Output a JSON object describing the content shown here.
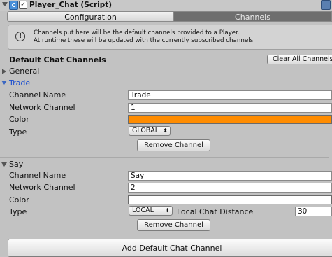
{
  "header": {
    "component_title": "Player_Chat (Script)",
    "enabled_check": "✓",
    "script_icon_glyph": "C"
  },
  "tabs": [
    {
      "label": "Configuration",
      "active": false
    },
    {
      "label": "Channels",
      "active": true
    }
  ],
  "helpbox": {
    "icon": "info-icon",
    "icon_glyph": "!",
    "line1": "Channels put here will be the default channels provided to a Player.",
    "line2": "At runtime these will be updated with the currently subscribed channels"
  },
  "section": {
    "title": "Default Chat Channels",
    "clear_all_label": "Clear All Channels"
  },
  "channels": [
    {
      "name": "General",
      "expanded": false
    },
    {
      "name": "Trade",
      "expanded": true,
      "fields": {
        "channel_name_label": "Channel Name",
        "channel_name_value": "Trade",
        "network_channel_label": "Network Channel",
        "network_channel_value": "1",
        "color_label": "Color",
        "color_value": "#ff8c00",
        "type_label": "Type",
        "type_value": "GLOBAL"
      },
      "remove_label": "Remove Channel"
    },
    {
      "name": "Say",
      "expanded": true,
      "fields": {
        "channel_name_label": "Channel Name",
        "channel_name_value": "Say",
        "network_channel_label": "Network Channel",
        "network_channel_value": "2",
        "color_label": "Color",
        "color_value": "#ffffff",
        "type_label": "Type",
        "type_value": "LOCAL",
        "local_distance_label": "Local Chat Distance",
        "local_distance_value": "30"
      },
      "remove_label": "Remove Channel"
    }
  ],
  "add_button_label": "Add Default Chat Channel",
  "colors": {
    "panel_bg": "#c2c2c2",
    "active_tab_bg": "#6e6e6e",
    "selected_text": "#1c4fcf"
  }
}
